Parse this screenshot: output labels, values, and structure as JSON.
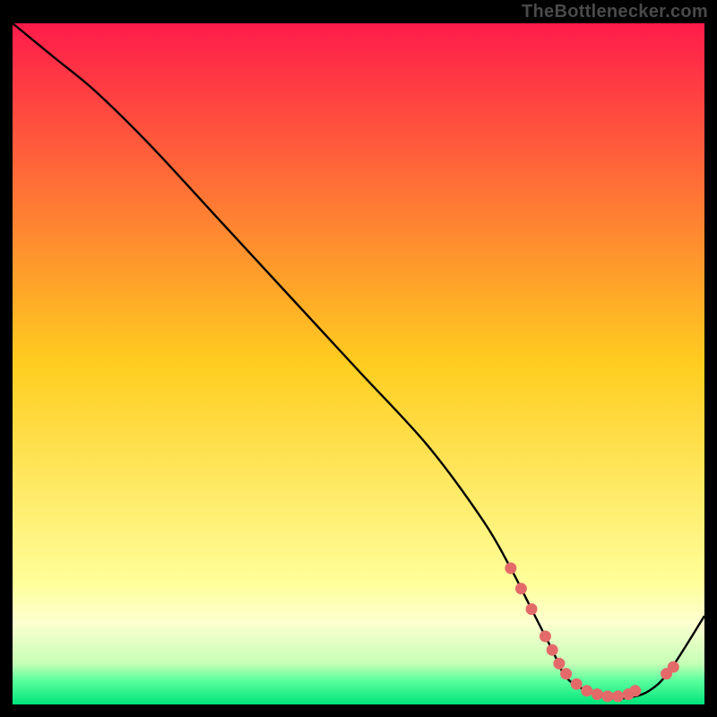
{
  "attribution": "TheBottlenecker.com",
  "chart_data": {
    "type": "line",
    "title": "",
    "xlabel": "",
    "ylabel": "",
    "xlim": [
      0,
      100
    ],
    "ylim": [
      0,
      100
    ],
    "gradient_stops": [
      {
        "offset": 0.0,
        "color": "#ff1b4b"
      },
      {
        "offset": 0.5,
        "color": "#ffcd1f"
      },
      {
        "offset": 0.82,
        "color": "#ffff99"
      },
      {
        "offset": 0.88,
        "color": "#fdffd0"
      },
      {
        "offset": 0.94,
        "color": "#c6ffb6"
      },
      {
        "offset": 0.965,
        "color": "#5bff9e"
      },
      {
        "offset": 1.0,
        "color": "#00e57a"
      }
    ],
    "series": [
      {
        "name": "bottleneck-curve",
        "x": [
          0,
          6,
          12,
          20,
          30,
          40,
          50,
          60,
          68,
          72,
          75,
          78,
          80,
          83,
          86,
          89,
          92,
          95,
          100
        ],
        "y": [
          100,
          95,
          90,
          82,
          71,
          60,
          49,
          38,
          27,
          20,
          14,
          8,
          4,
          2,
          1,
          1,
          2,
          5,
          13
        ]
      }
    ],
    "markers": {
      "name": "highlight-dots",
      "color": "#e46a6a",
      "points": [
        {
          "x": 72.0,
          "y": 20.0
        },
        {
          "x": 73.5,
          "y": 17.0
        },
        {
          "x": 75.0,
          "y": 14.0
        },
        {
          "x": 77.0,
          "y": 10.0
        },
        {
          "x": 78.0,
          "y": 8.0
        },
        {
          "x": 79.0,
          "y": 6.0
        },
        {
          "x": 80.0,
          "y": 4.5
        },
        {
          "x": 81.5,
          "y": 3.0
        },
        {
          "x": 83.0,
          "y": 2.0
        },
        {
          "x": 84.5,
          "y": 1.5
        },
        {
          "x": 86.0,
          "y": 1.2
        },
        {
          "x": 87.5,
          "y": 1.2
        },
        {
          "x": 89.0,
          "y": 1.5
        },
        {
          "x": 90.0,
          "y": 2.0
        },
        {
          "x": 94.5,
          "y": 4.5
        },
        {
          "x": 95.5,
          "y": 5.5
        }
      ]
    }
  }
}
